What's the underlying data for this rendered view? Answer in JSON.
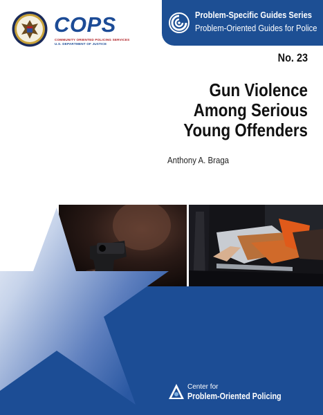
{
  "header": {
    "cops_logo": "COPS",
    "cops_subtitle": "COMMUNITY ORIENTED POLICING SERVICES",
    "cops_department": "U.S. DEPARTMENT OF JUSTICE",
    "series_line1": "Problem-Specific Guides Series",
    "series_line2": "Problem-Oriented Guides for Police",
    "series_color": "#1d4f94"
  },
  "guide": {
    "number": "No. 23",
    "title_lines": [
      "Gun Violence",
      "Among Serious",
      "Young Offenders"
    ],
    "author": "Anthony A. Braga"
  },
  "photos": {
    "left": "handgun-photo",
    "right": "stretcher-photo"
  },
  "footer": {
    "center_line1": "Center for",
    "center_line2": "Problem-Oriented Policing",
    "panel_color": "#1c4d95"
  }
}
